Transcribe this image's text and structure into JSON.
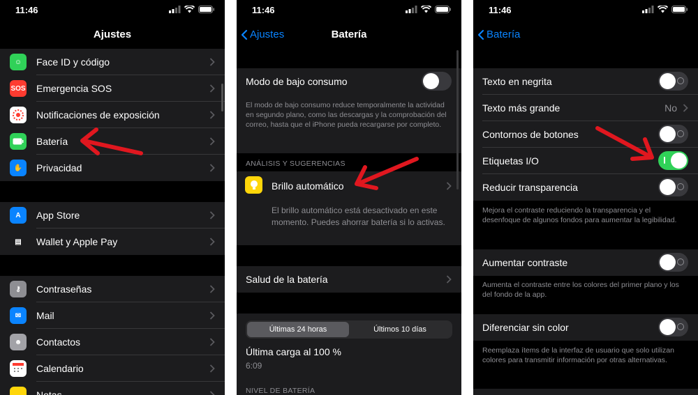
{
  "status": {
    "time": "11:46"
  },
  "screen1": {
    "title": "Ajustes",
    "group1": [
      {
        "label": "Face ID y código",
        "icon": "face-id-icon",
        "color": "#30d158",
        "glyph": "☺"
      },
      {
        "label": "Emergencia SOS",
        "icon": "sos-icon",
        "color": "#ff3b30",
        "glyph": "SOS"
      },
      {
        "label": "Notificaciones de exposición",
        "icon": "exposure-icon",
        "color": "#ffffff",
        "glyph": ""
      },
      {
        "label": "Batería",
        "icon": "battery-icon",
        "color": "#30d158",
        "glyph": "▬"
      },
      {
        "label": "Privacidad",
        "icon": "hand-icon",
        "color": "#0a84ff",
        "glyph": "✋"
      }
    ],
    "group2": [
      {
        "label": "App Store",
        "icon": "app-store-icon",
        "color": "#0a84ff",
        "glyph": "A"
      },
      {
        "label": "Wallet y Apple Pay",
        "icon": "wallet-icon",
        "color": "#1c1c1e",
        "glyph": "▤"
      }
    ],
    "group3": [
      {
        "label": "Contraseñas",
        "icon": "key-icon",
        "color": "#8e8e93",
        "glyph": "⚷"
      },
      {
        "label": "Mail",
        "icon": "mail-icon",
        "color": "#0a84ff",
        "glyph": "✉"
      },
      {
        "label": "Contactos",
        "icon": "contacts-icon",
        "color": "#a2a2a7",
        "glyph": "☻"
      },
      {
        "label": "Calendario",
        "icon": "calendar-icon",
        "color": "#ffffff",
        "glyph": ""
      },
      {
        "label": "Notas",
        "icon": "notes-icon",
        "color": "#ffd60a",
        "glyph": ""
      }
    ]
  },
  "screen2": {
    "back": "Ajustes",
    "title": "Batería",
    "low_power": {
      "label": "Modo de bajo consumo",
      "on": false
    },
    "low_power_footer": "El modo de bajo consumo reduce temporalmente la actividad en segundo plano, como las descargas y la comprobación del correo, hasta que el iPhone pueda recargarse por completo.",
    "insights_header": "ANÁLISIS Y SUGERENCIAS",
    "auto_brightness": {
      "label": "Brillo automático",
      "desc": "El brillo automático está desactivado en este momento. Puedes ahorrar batería si lo activas."
    },
    "battery_health": "Salud de la batería",
    "segments": [
      "Últimas 24 horas",
      "Últimos 10 días"
    ],
    "last_charge": "Última carga al 100 %",
    "last_charge_time": "6:09",
    "level_header": "NIVEL DE BATERÍA"
  },
  "screen3": {
    "back": "Batería",
    "group1": [
      {
        "label": "Texto en negrita",
        "type": "toggle",
        "on": false
      },
      {
        "label": "Texto más grande",
        "type": "value",
        "value": "No"
      },
      {
        "label": "Contornos de botones",
        "type": "toggle",
        "on": false
      },
      {
        "label": "Etiquetas I/O",
        "type": "toggle",
        "on": true
      },
      {
        "label": "Reducir transparencia",
        "type": "toggle",
        "on": false
      }
    ],
    "footer1": "Mejora el contraste reduciendo la transparencia y el desenfoque de algunos fondos para aumentar la legibilidad.",
    "increase_contrast": "Aumentar contraste",
    "footer2": "Aumenta el contraste entre los colores del primer plano y los del fondo de la app.",
    "differentiate": "Diferenciar sin color",
    "footer3": "Reemplaza ítems de la interfaz de usuario que solo utilizan colores para transmitir información por otras alternativas."
  },
  "colors": {
    "accent": "#0a84ff",
    "arrow": "#e0171f",
    "toggle_on": "#30d158"
  }
}
